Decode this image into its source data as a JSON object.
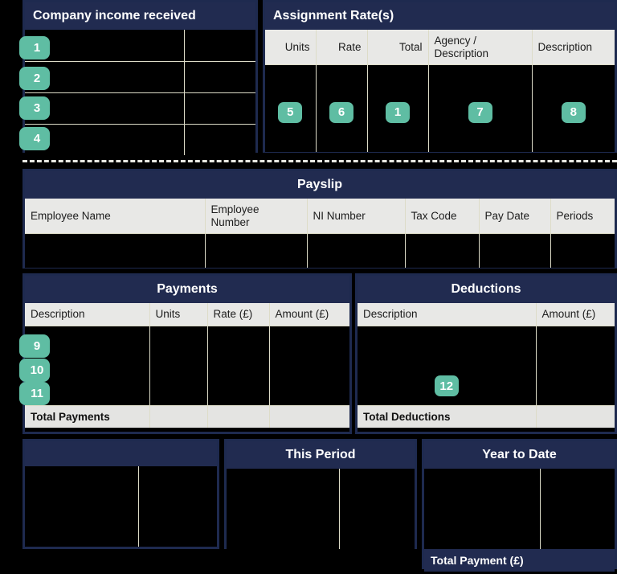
{
  "colors": {
    "panel_header": "#212b50",
    "panel_border": "#1e2a4f",
    "grid_line": "#dddcc8",
    "column_header_bg": "#e8e8e6",
    "body_bg": "#000000",
    "badge": "#5fbda3",
    "text_light": "#ffffff",
    "text_dark": "#1c1c1c"
  },
  "company_income": {
    "title": "Company income received",
    "row_badges": [
      "1",
      "2",
      "3",
      "4"
    ],
    "row_count": 4,
    "column_count": 2
  },
  "assignment_rates": {
    "title": "Assignment Rate(s)",
    "columns": [
      {
        "label": "Units",
        "align": "right"
      },
      {
        "label": "Rate",
        "align": "right"
      },
      {
        "label": "Total",
        "align": "right"
      },
      {
        "label": "Agency /\nDescription",
        "align": "left"
      },
      {
        "label": "Description",
        "align": "left"
      }
    ],
    "cell_badges": [
      "5",
      "6",
      "1",
      "7",
      "8"
    ]
  },
  "payslip": {
    "title": "Payslip",
    "columns": [
      "Employee Name",
      "Employee Number",
      "NI Number",
      "Tax Code",
      "Pay Date",
      "Periods"
    ],
    "values": [
      "",
      "",
      "",
      "",
      "",
      ""
    ]
  },
  "payments": {
    "title": "Payments",
    "columns": [
      "Description",
      "Units",
      "Rate (£)",
      "Amount (£)"
    ],
    "row_badges": [
      "9",
      "10",
      "11"
    ],
    "footer_label": "Total Payments",
    "footer_values": [
      "",
      "",
      ""
    ]
  },
  "deductions": {
    "title": "Deductions",
    "columns": [
      "Description",
      "Amount (£)"
    ],
    "cell_badge": "12",
    "footer_label": "Total Deductions",
    "footer_values": [
      ""
    ]
  },
  "summary_left": {
    "title": "",
    "column_count": 2,
    "values": [
      "",
      ""
    ]
  },
  "this_period": {
    "title": "This Period",
    "column_count": 2,
    "values": [
      "",
      ""
    ]
  },
  "year_to_date": {
    "title": "Year to Date",
    "column_count": 2,
    "values": [
      "",
      ""
    ],
    "footer_label": "Total Payment (£)",
    "footer_value": ""
  }
}
